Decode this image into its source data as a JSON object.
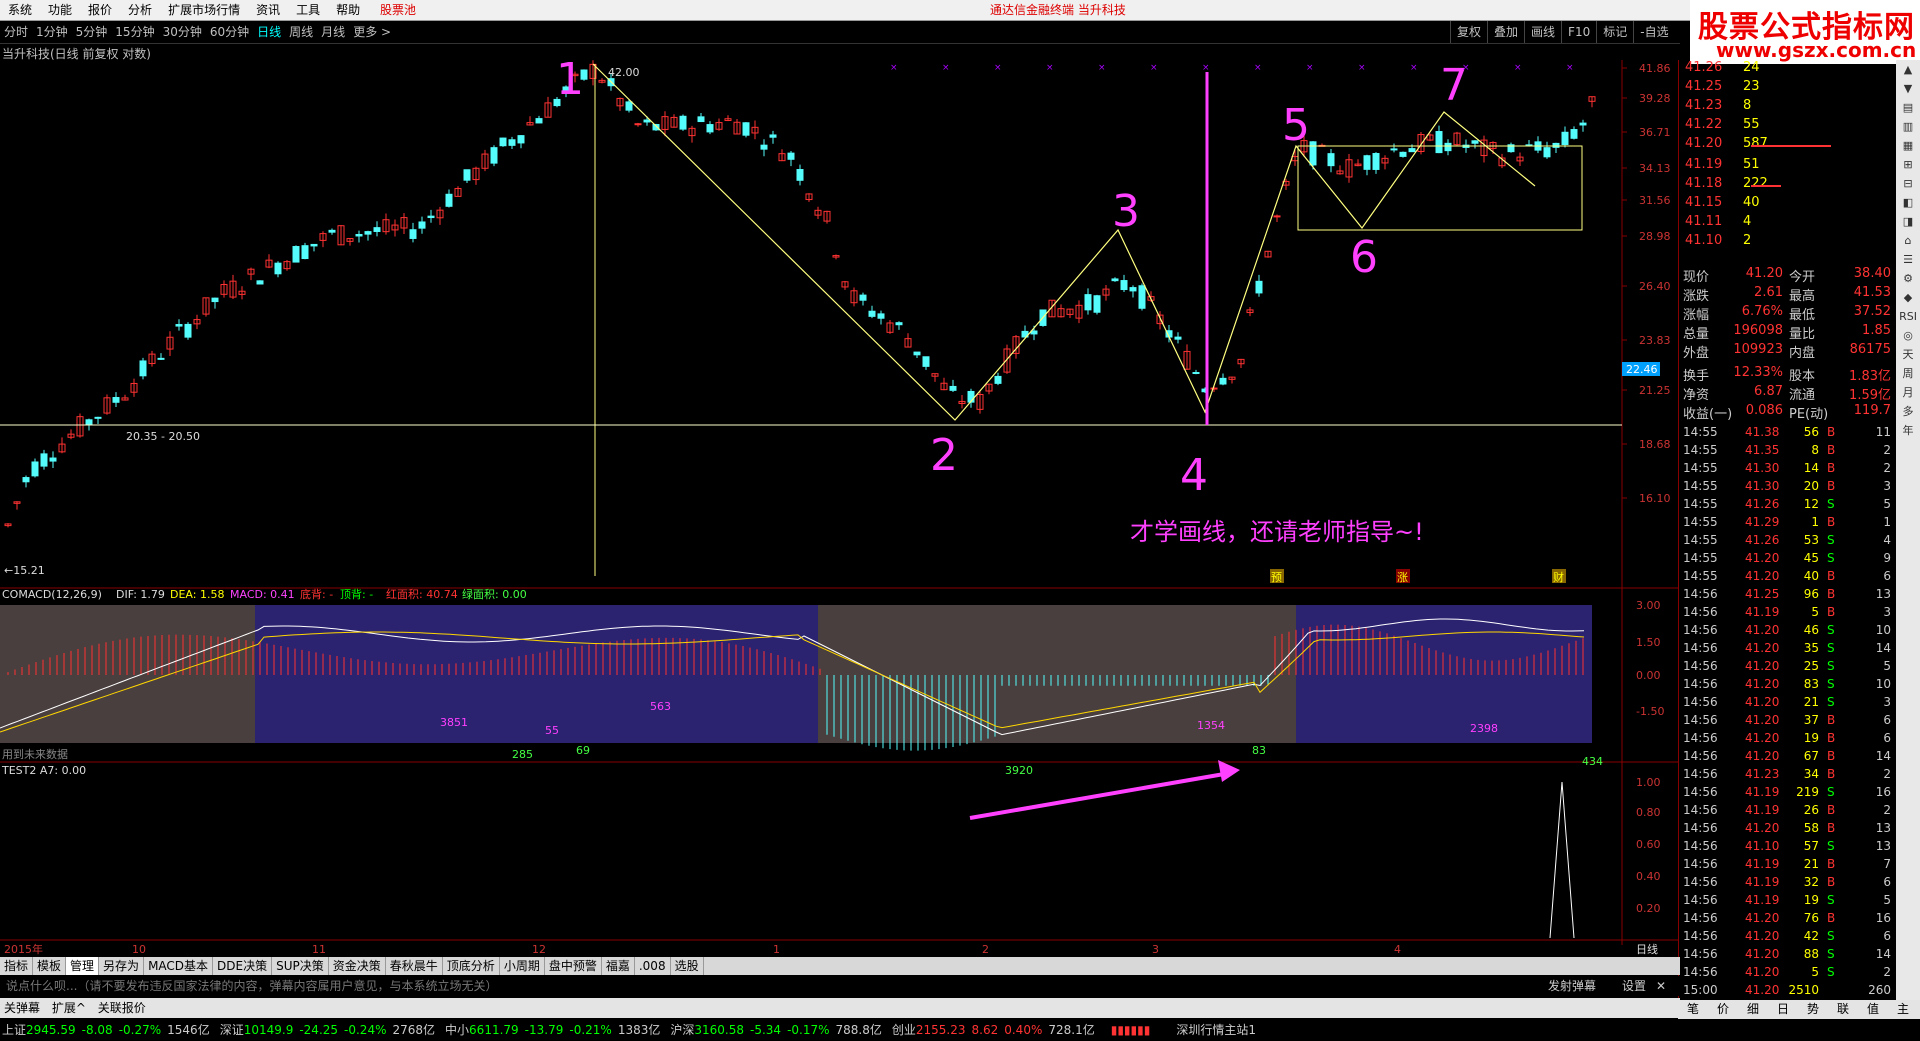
{
  "menu": [
    "系统",
    "功能",
    "报价",
    "分析",
    "扩展市场行情",
    "资讯",
    "工具",
    "帮助"
  ],
  "menu_hot": "股票池",
  "center_title": "通达信金融终端   当升科技",
  "logo": {
    "line1": "股票公式指标网",
    "line2": "www.gszx.com.cn"
  },
  "periods": [
    "分时",
    "1分钟",
    "5分钟",
    "15分钟",
    "30分钟",
    "60分钟",
    "日线",
    "周线",
    "月线",
    "更多 >"
  ],
  "period_selected": "日线",
  "right_buttons": [
    "复权",
    "叠加",
    "画线",
    "F10",
    "标记",
    "-自选"
  ],
  "stock_title": "当升科技(日线 前复权 对数)",
  "chart_data": {
    "type": "candlestick",
    "y_ticks": [
      "41.86",
      "39.28",
      "36.71",
      "34.13",
      "31.56",
      "28.98",
      "26.40",
      "23.83",
      "21.25",
      "18.68",
      "16.10"
    ],
    "annotations": {
      "high_label": "42.00",
      "support_label": "20.35 - 20.50",
      "low_label": "←15.21",
      "current_price_tag": "22.46",
      "wave_numbers": [
        "1",
        "2",
        "3",
        "4",
        "5",
        "6",
        "7"
      ],
      "comment": "才学画线，还请老师指导~!",
      "markers": [
        "预",
        "涨",
        "财"
      ]
    },
    "x_ticks": [
      "2015年",
      "10",
      "11",
      "12",
      "1",
      "2",
      "3",
      "4"
    ],
    "macd": {
      "title": "COMACD(12,26,9)",
      "dif": "DIF: 1.79",
      "dea": "DEA: 1.58",
      "macd": "MACD: 0.41",
      "flags": [
        "底背: -",
        "顶背: -"
      ],
      "red": "红面积: 40.74",
      "green": "绿面积: 0.00",
      "y_ticks": [
        "3.00",
        "1.50",
        "0.00",
        "-1.50"
      ],
      "area_labels": [
        "3851",
        "285",
        "55",
        "69",
        "563",
        "3920",
        "1354",
        "83",
        "2398",
        "434"
      ],
      "future_note": "用到未来数据"
    },
    "test2": {
      "title": "TEST2 A7: 0.00",
      "y_ticks": [
        "1.00",
        "0.80",
        "0.60",
        "0.40",
        "0.20"
      ]
    },
    "scroll_right": "日线"
  },
  "orderbook": [
    {
      "p": "41.26",
      "v": "24",
      "w": 0
    },
    {
      "p": "41.25",
      "v": "23",
      "w": 0
    },
    {
      "p": "41.23",
      "v": "8",
      "w": 0
    },
    {
      "p": "41.22",
      "v": "55",
      "w": 0
    },
    {
      "p": "41.20",
      "v": "587",
      "w": 1
    },
    {
      "p": "41.19",
      "v": "51",
      "w": 0
    },
    {
      "p": "41.18",
      "v": "222",
      "w": 0.38
    },
    {
      "p": "41.15",
      "v": "40",
      "w": 0
    },
    {
      "p": "41.11",
      "v": "4",
      "w": 0
    },
    {
      "p": "41.10",
      "v": "2",
      "w": 0
    }
  ],
  "quote": [
    {
      "k": "现价",
      "a": "41.20",
      "k2": "今开",
      "b": "38.40"
    },
    {
      "k": "涨跌",
      "a": "2.61",
      "k2": "最高",
      "b": "41.53"
    },
    {
      "k": "涨幅",
      "a": "6.76%",
      "k2": "最低",
      "b": "37.52"
    },
    {
      "k": "总量",
      "a": "196098",
      "k2": "量比",
      "b": "1.85"
    },
    {
      "k": "外盘",
      "a": "109923",
      "k2": "内盘",
      "b": "86175"
    },
    {
      "k": "换手",
      "a": "12.33%",
      "k2": "股本",
      "b": "1.83亿"
    },
    {
      "k": "净资",
      "a": "6.87",
      "k2": "流通",
      "b": "1.59亿"
    },
    {
      "k": "收益(一)",
      "a": "0.086",
      "k2": "PE(动)",
      "b": "119.7"
    }
  ],
  "ticks": [
    [
      "14:55",
      "41.38",
      "56",
      "B",
      "11"
    ],
    [
      "14:55",
      "41.35",
      "8",
      "B",
      "2"
    ],
    [
      "14:55",
      "41.30",
      "14",
      "B",
      "2"
    ],
    [
      "14:55",
      "41.30",
      "20",
      "B",
      "3"
    ],
    [
      "14:55",
      "41.26",
      "12",
      "S",
      "5"
    ],
    [
      "14:55",
      "41.29",
      "1",
      "B",
      "1"
    ],
    [
      "14:55",
      "41.26",
      "53",
      "S",
      "4"
    ],
    [
      "14:55",
      "41.20",
      "45",
      "S",
      "9"
    ],
    [
      "14:55",
      "41.20",
      "40",
      "B",
      "6"
    ],
    [
      "14:56",
      "41.25",
      "96",
      "B",
      "13"
    ],
    [
      "14:56",
      "41.19",
      "5",
      "B",
      "3"
    ],
    [
      "14:56",
      "41.20",
      "46",
      "S",
      "10"
    ],
    [
      "14:56",
      "41.20",
      "35",
      "S",
      "14"
    ],
    [
      "14:56",
      "41.20",
      "25",
      "S",
      "5"
    ],
    [
      "14:56",
      "41.20",
      "83",
      "S",
      "10"
    ],
    [
      "14:56",
      "41.20",
      "21",
      "S",
      "3"
    ],
    [
      "14:56",
      "41.20",
      "37",
      "B",
      "6"
    ],
    [
      "14:56",
      "41.20",
      "19",
      "B",
      "6"
    ],
    [
      "14:56",
      "41.20",
      "67",
      "B",
      "14"
    ],
    [
      "14:56",
      "41.23",
      "34",
      "B",
      "2"
    ],
    [
      "14:56",
      "41.19",
      "219",
      "S",
      "16"
    ],
    [
      "14:56",
      "41.19",
      "26",
      "B",
      "2"
    ],
    [
      "14:56",
      "41.20",
      "58",
      "B",
      "13"
    ],
    [
      "14:56",
      "41.10",
      "57",
      "S",
      "13"
    ],
    [
      "14:56",
      "41.19",
      "21",
      "B",
      "7"
    ],
    [
      "14:56",
      "41.19",
      "32",
      "B",
      "6"
    ],
    [
      "14:56",
      "41.19",
      "19",
      "S",
      "5"
    ],
    [
      "14:56",
      "41.20",
      "76",
      "B",
      "16"
    ],
    [
      "14:56",
      "41.20",
      "42",
      "S",
      "6"
    ],
    [
      "14:56",
      "41.20",
      "88",
      "S",
      "14"
    ],
    [
      "14:56",
      "41.20",
      "5",
      "S",
      "2"
    ],
    [
      "15:00",
      "41.20",
      "2510",
      "",
      "260"
    ]
  ],
  "vtools": [
    "▲",
    "▼",
    "▤",
    "▥",
    "▦",
    "⊞",
    "⊟",
    "◧",
    "◨",
    "⌂",
    "☰",
    "⚙",
    "◆",
    "RSI",
    "◎",
    "天",
    "周",
    "月",
    "多",
    "年"
  ],
  "bottom_tabs": [
    "指标",
    "模板",
    "管理",
    "另存为",
    "MACD基本",
    "DDE决策",
    "SUP决策",
    "资金决策",
    "春秋晨牛",
    "顶底分析",
    "小周期",
    "盘中预警",
    "福嘉",
    ".008",
    "选股"
  ],
  "bottom_tab_selected": "管理",
  "chat_placeholder": "说点什么呗...（请不要发布违反国家法律的内容，弹幕内容属用户意见，与本系统立场无关）",
  "chat_right": [
    "发射弹幕",
    "设置"
  ],
  "status1": [
    "关弹幕",
    "扩展^",
    "关联报价"
  ],
  "indices": [
    {
      "name": "上证",
      "val": "2945.59",
      "chg": "-8.08",
      "pct": "-0.27%",
      "amt": "1546亿",
      "dir": "dn"
    },
    {
      "name": "深证",
      "val": "10149.9",
      "chg": "-24.25",
      "pct": "-0.24%",
      "amt": "2768亿",
      "dir": "dn"
    },
    {
      "name": "中小",
      "val": "6611.79",
      "chg": "-13.79",
      "pct": "-0.21%",
      "amt": "1383亿",
      "dir": "dn"
    },
    {
      "name": "沪深",
      "val": "3160.58",
      "chg": "-5.34",
      "pct": "-0.17%",
      "amt": "788.8亿",
      "dir": "dn"
    },
    {
      "name": "创业",
      "val": "2155.23",
      "chg": "8.62",
      "pct": "0.40%",
      "amt": "728.1亿",
      "dir": "up"
    }
  ],
  "server": "深圳行情主站1",
  "right_bottom_tabs": [
    "笔",
    "价",
    "细",
    "日",
    "势",
    "联",
    "值",
    "主"
  ]
}
